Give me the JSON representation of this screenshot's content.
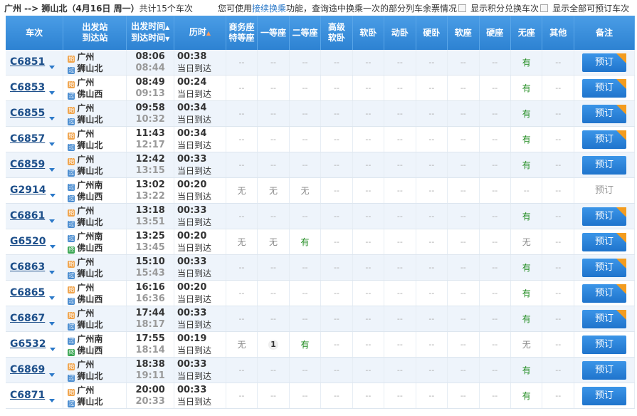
{
  "header": {
    "route": "广州 --> 狮山北",
    "date": "（4月16日  周一）",
    "count": "共计15个车次",
    "tip_pre": "您可使用",
    "tip_link": "接续换乘",
    "tip_post": "功能，查询途中换乘一次的部分列车余票情况",
    "opt1": "显示积分兑换车次",
    "opt2": "显示全部可预订车次"
  },
  "columns": {
    "train": "车次",
    "stn1": "出发站",
    "stn2": "到达站",
    "time1": "出发时间",
    "time2": "到达时间",
    "dur": "历时",
    "c_biz1": "商务座",
    "c_biz2": "特等座",
    "c_first": "一等座",
    "c_second": "二等座",
    "c_hs1": "高级",
    "c_hs2": "软卧",
    "c_soft_sleeper": "软卧",
    "c_moving": "动卧",
    "c_hard_sleeper": "硬卧",
    "c_soft_seat": "软座",
    "c_hard_seat": "硬座",
    "c_none": "无座",
    "c_other": "其他",
    "c_note": "备注"
  },
  "rows": [
    {
      "train": "C6851",
      "from": "广州",
      "to": "狮山北",
      "from_type": "start",
      "to_type": "pass",
      "dep": "08:06",
      "arr": "08:44",
      "dur": "00:38",
      "arrive": "当日到达",
      "seats": [
        "--",
        "--",
        "--",
        "--",
        "--",
        "--",
        "--",
        "--",
        "--",
        "有",
        "--"
      ],
      "book": "预订",
      "corner": true
    },
    {
      "train": "C6853",
      "from": "广州",
      "to": "佛山西",
      "from_type": "start",
      "to_type": "pass",
      "dep": "08:49",
      "arr": "09:13",
      "dur": "00:24",
      "arrive": "当日到达",
      "seats": [
        "--",
        "--",
        "--",
        "--",
        "--",
        "--",
        "--",
        "--",
        "--",
        "有",
        "--"
      ],
      "book": "预订",
      "corner": true
    },
    {
      "train": "C6855",
      "from": "广州",
      "to": "狮山北",
      "from_type": "start",
      "to_type": "pass",
      "dep": "09:58",
      "arr": "10:32",
      "dur": "00:34",
      "arrive": "当日到达",
      "seats": [
        "--",
        "--",
        "--",
        "--",
        "--",
        "--",
        "--",
        "--",
        "--",
        "有",
        "--"
      ],
      "book": "预订",
      "corner": true
    },
    {
      "train": "C6857",
      "from": "广州",
      "to": "狮山北",
      "from_type": "start",
      "to_type": "pass",
      "dep": "11:43",
      "arr": "12:17",
      "dur": "00:34",
      "arrive": "当日到达",
      "seats": [
        "--",
        "--",
        "--",
        "--",
        "--",
        "--",
        "--",
        "--",
        "--",
        "有",
        "--"
      ],
      "book": "预订",
      "corner": true
    },
    {
      "train": "C6859",
      "from": "广州",
      "to": "狮山北",
      "from_type": "start",
      "to_type": "pass",
      "dep": "12:42",
      "arr": "13:15",
      "dur": "00:33",
      "arrive": "当日到达",
      "seats": [
        "--",
        "--",
        "--",
        "--",
        "--",
        "--",
        "--",
        "--",
        "--",
        "有",
        "--"
      ],
      "book": "预订",
      "corner": false
    },
    {
      "train": "G2914",
      "from": "广州南",
      "to": "佛山西",
      "from_type": "pass",
      "to_type": "pass",
      "dep": "13:02",
      "arr": "13:22",
      "dur": "00:20",
      "arrive": "当日到达",
      "seats": [
        "无",
        "无",
        "无",
        "--",
        "--",
        "--",
        "--",
        "--",
        "--",
        "--",
        "--"
      ],
      "book": "预订",
      "corner": false,
      "disabled": true
    },
    {
      "train": "C6861",
      "from": "广州",
      "to": "狮山北",
      "from_type": "start",
      "to_type": "pass",
      "dep": "13:18",
      "arr": "13:51",
      "dur": "00:33",
      "arrive": "当日到达",
      "seats": [
        "--",
        "--",
        "--",
        "--",
        "--",
        "--",
        "--",
        "--",
        "--",
        "有",
        "--"
      ],
      "book": "预订",
      "corner": true
    },
    {
      "train": "G6520",
      "from": "广州南",
      "to": "佛山西",
      "from_type": "pass",
      "to_type": "end",
      "dep": "13:25",
      "arr": "13:45",
      "dur": "00:20",
      "arrive": "当日到达",
      "seats": [
        "无",
        "无",
        "有",
        "--",
        "--",
        "--",
        "--",
        "--",
        "--",
        "无",
        "--"
      ],
      "book": "预订",
      "corner": true
    },
    {
      "train": "C6863",
      "from": "广州",
      "to": "狮山北",
      "from_type": "start",
      "to_type": "pass",
      "dep": "15:10",
      "arr": "15:43",
      "dur": "00:33",
      "arrive": "当日到达",
      "seats": [
        "--",
        "--",
        "--",
        "--",
        "--",
        "--",
        "--",
        "--",
        "--",
        "有",
        "--"
      ],
      "book": "预订",
      "corner": true
    },
    {
      "train": "C6865",
      "from": "广州",
      "to": "佛山西",
      "from_type": "start",
      "to_type": "pass",
      "dep": "16:16",
      "arr": "16:36",
      "dur": "00:20",
      "arrive": "当日到达",
      "seats": [
        "--",
        "--",
        "--",
        "--",
        "--",
        "--",
        "--",
        "--",
        "--",
        "有",
        "--"
      ],
      "book": "预订",
      "corner": true
    },
    {
      "train": "C6867",
      "from": "广州",
      "to": "狮山北",
      "from_type": "start",
      "to_type": "pass",
      "dep": "17:44",
      "arr": "18:17",
      "dur": "00:33",
      "arrive": "当日到达",
      "seats": [
        "--",
        "--",
        "--",
        "--",
        "--",
        "--",
        "--",
        "--",
        "--",
        "有",
        "--"
      ],
      "book": "预订",
      "corner": true
    },
    {
      "train": "G6532",
      "from": "广州南",
      "to": "佛山西",
      "from_type": "pass",
      "to_type": "end",
      "dep": "17:55",
      "arr": "18:14",
      "dur": "00:19",
      "arrive": "当日到达",
      "seats": [
        "无",
        "1",
        "有",
        "--",
        "--",
        "--",
        "--",
        "--",
        "--",
        "无",
        "--"
      ],
      "book": "预订",
      "corner": false
    },
    {
      "train": "C6869",
      "from": "广州",
      "to": "狮山北",
      "from_type": "start",
      "to_type": "pass",
      "dep": "18:38",
      "arr": "19:11",
      "dur": "00:33",
      "arrive": "当日到达",
      "seats": [
        "--",
        "--",
        "--",
        "--",
        "--",
        "--",
        "--",
        "--",
        "--",
        "有",
        "--"
      ],
      "book": "预订",
      "corner": false
    },
    {
      "train": "C6871",
      "from": "广州",
      "to": "狮山北",
      "from_type": "start",
      "to_type": "pass",
      "dep": "20:00",
      "arr": "20:33",
      "dur": "00:33",
      "arrive": "当日到达",
      "seats": [
        "--",
        "--",
        "--",
        "--",
        "--",
        "--",
        "--",
        "--",
        "--",
        "有",
        "--"
      ],
      "book": "预订",
      "corner": false
    }
  ]
}
